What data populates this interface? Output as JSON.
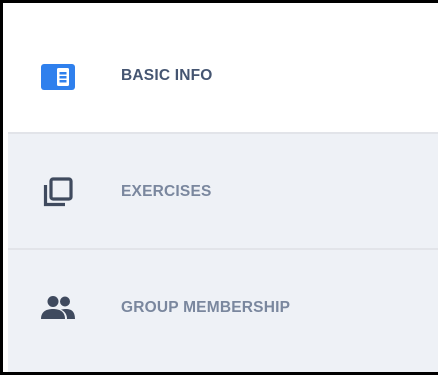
{
  "nav": {
    "items": [
      {
        "label": "BASIC INFO",
        "icon": "basic-info-card-icon",
        "active": true
      },
      {
        "label": "EXERCISES",
        "icon": "exercises-stack-icon",
        "active": false
      },
      {
        "label": "GROUP MEMBERSHIP",
        "icon": "group-people-icon",
        "active": false
      }
    ]
  },
  "colors": {
    "active_icon": "#2f80ed",
    "active_text": "#455571",
    "inactive_text": "#7a879e",
    "inactive_icon": "#3f4a5e",
    "inactive_bg": "#eef1f6",
    "divider": "#e2e4e9"
  }
}
